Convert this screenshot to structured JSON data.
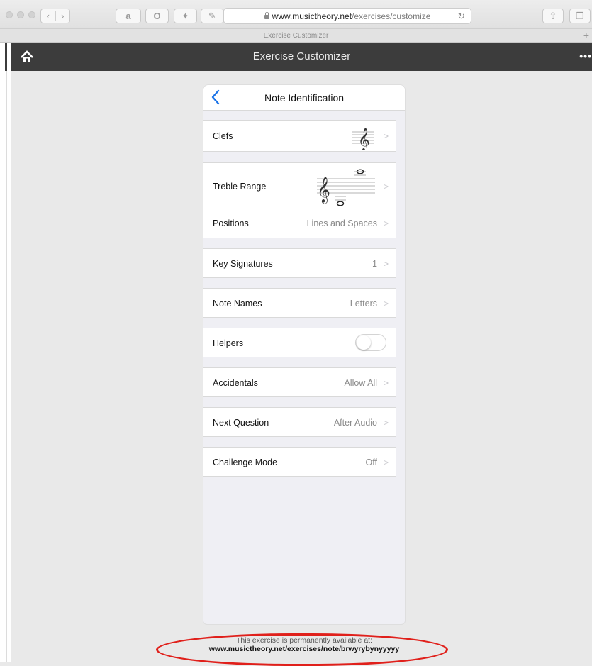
{
  "browser": {
    "url_host": "www.musictheory.net",
    "url_path": "/exercises/customize",
    "tab_title": "Exercise Customizer",
    "toolbar_buttons": [
      "back",
      "forward",
      "amazon",
      "opera",
      "bookmark",
      "notes"
    ]
  },
  "app_header": {
    "title": "Exercise Customizer",
    "home_icon": "home-icon",
    "more_icon": "more-icon",
    "more_glyph": "•••"
  },
  "card": {
    "title": "Note Identification",
    "rows": [
      {
        "label": "Clefs",
        "value": ""
      },
      {
        "label": "Treble Range",
        "value": ""
      },
      {
        "label": "Positions",
        "value": "Lines and Spaces"
      },
      {
        "label": "Key Signatures",
        "value": "1"
      },
      {
        "label": "Note Names",
        "value": "Letters"
      },
      {
        "label": "Helpers",
        "value": "",
        "toggle": false
      },
      {
        "label": "Accidentals",
        "value": "Allow All"
      },
      {
        "label": "Next Question",
        "value": "After Audio"
      },
      {
        "label": "Challenge Mode",
        "value": "Off"
      }
    ],
    "chevron_glyph": ">"
  },
  "footer": {
    "line1": "This exercise is permanently available at:",
    "line2": "www.musictheory.net/exercises/note/brwyrybynyyyyy"
  },
  "colors": {
    "header_bg": "#3c3c3c",
    "accent_blue": "#1a73e8",
    "highlight_red": "#e0201b",
    "grouped_bg": "#efeff4"
  }
}
